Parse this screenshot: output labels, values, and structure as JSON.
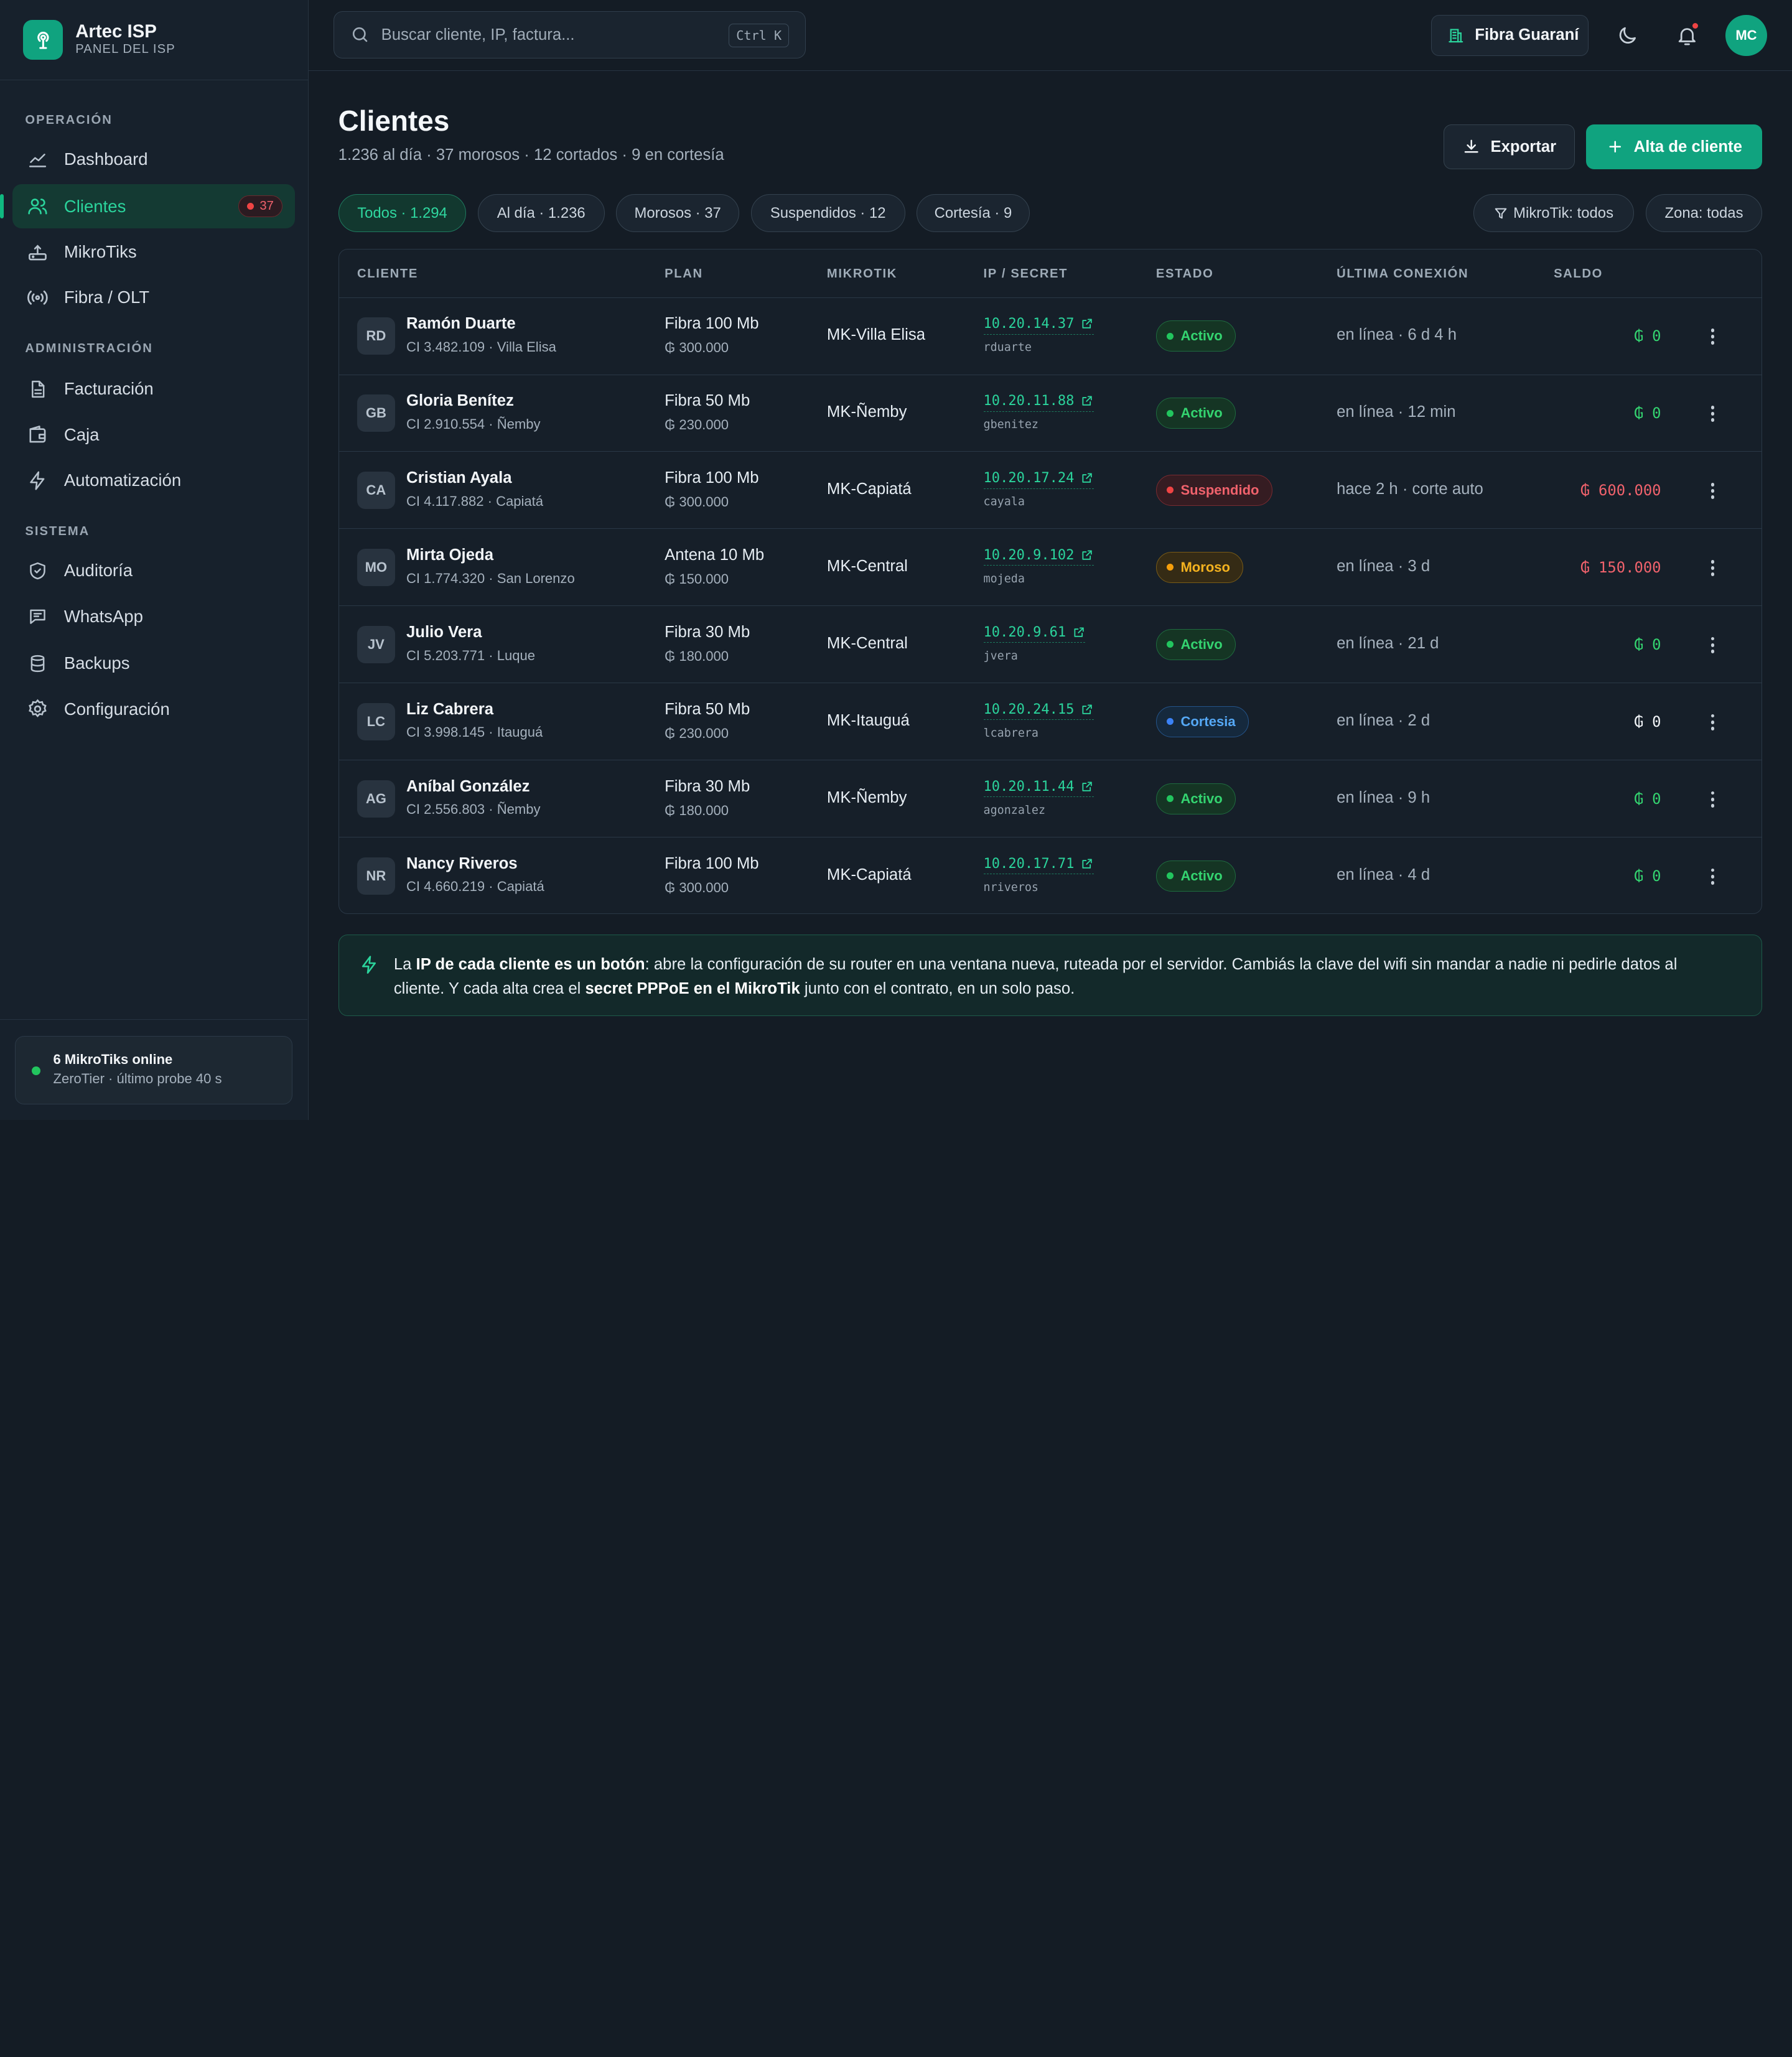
{
  "brand": {
    "name": "Artec ISP",
    "subtitle": "PANEL DEL ISP"
  },
  "sidebar": {
    "sections": [
      "OPERACIÓN",
      "ADMINISTRACIÓN",
      "SISTEMA"
    ],
    "items": [
      {
        "label": "Dashboard",
        "icon": "chart-line-icon"
      },
      {
        "label": "Clientes",
        "icon": "users-icon",
        "badge": "37",
        "active": true
      },
      {
        "label": "MikroTiks",
        "icon": "router-icon"
      },
      {
        "label": "Fibra / OLT",
        "icon": "broadcast-icon"
      },
      {
        "label": "Facturación",
        "icon": "invoice-icon"
      },
      {
        "label": "Caja",
        "icon": "wallet-icon"
      },
      {
        "label": "Automatización",
        "icon": "bolt-icon"
      },
      {
        "label": "Auditoría",
        "icon": "shield-icon"
      },
      {
        "label": "WhatsApp",
        "icon": "chat-icon"
      },
      {
        "label": "Backups",
        "icon": "database-icon"
      },
      {
        "label": "Configuración",
        "icon": "gear-icon"
      }
    ],
    "status": {
      "title": "6 MikroTiks online",
      "subtitle": "ZeroTier · último probe 40 s"
    }
  },
  "topbar": {
    "search_placeholder": "Buscar cliente, IP, factura...",
    "shortcut": "Ctrl K",
    "tenant": "Fibra Guaraní",
    "user_initials": "MC"
  },
  "page": {
    "title": "Clientes",
    "subtitle": "1.236 al día · 37 morosos · 12 cortados · 9 en cortesía",
    "export_label": "Exportar",
    "new_label": "Alta de cliente"
  },
  "filters": [
    "Todos · 1.294",
    "Al día · 1.236",
    "Morosos · 37",
    "Suspendidos · 12",
    "Cortesía · 9"
  ],
  "right_filters": [
    "MikroTik: todos",
    "Zona: todas"
  ],
  "table": {
    "columns": [
      "CLIENTE",
      "PLAN",
      "MIKROTIK",
      "IP / SECRET",
      "ESTADO",
      "ÚLTIMA CONEXIÓN",
      "SALDO"
    ],
    "rows": [
      {
        "initials": "RD",
        "name": "Ramón Duarte",
        "meta": "CI 3.482.109 · Villa Elisa",
        "plan": "Fibra 100 Mb",
        "price": "₲ 300.000",
        "mikrotik": "MK-Villa Elisa",
        "ip": "10.20.14.37",
        "secret": "rduarte",
        "state": "Activo",
        "state_kind": "active",
        "conn": "en línea · 6 d 4 h",
        "balance": "₲ 0",
        "bal_kind": "ok"
      },
      {
        "initials": "GB",
        "name": "Gloria Benítez",
        "meta": "CI 2.910.554 · Ñemby",
        "plan": "Fibra 50 Mb",
        "price": "₲ 230.000",
        "mikrotik": "MK-Ñemby",
        "ip": "10.20.11.88",
        "secret": "gbenitez",
        "state": "Activo",
        "state_kind": "active",
        "conn": "en línea · 12 min",
        "balance": "₲ 0",
        "bal_kind": "ok"
      },
      {
        "initials": "CA",
        "name": "Cristian Ayala",
        "meta": "CI 4.117.882 · Capiatá",
        "plan": "Fibra 100 Mb",
        "price": "₲ 300.000",
        "mikrotik": "MK-Capiatá",
        "ip": "10.20.17.24",
        "secret": "cayala",
        "state": "Suspendido",
        "state_kind": "suspended",
        "conn": "hace 2 h · corte auto",
        "balance": "₲ 600.000",
        "bal_kind": "debt"
      },
      {
        "initials": "MO",
        "name": "Mirta Ojeda",
        "meta": "CI 1.774.320 · San Lorenzo",
        "plan": "Antena 10 Mb",
        "price": "₲ 150.000",
        "mikrotik": "MK-Central",
        "ip": "10.20.9.102",
        "secret": "mojeda",
        "state": "Moroso",
        "state_kind": "late",
        "conn": "en línea · 3 d",
        "balance": "₲ 150.000",
        "bal_kind": "debt"
      },
      {
        "initials": "JV",
        "name": "Julio Vera",
        "meta": "CI 5.203.771 · Luque",
        "plan": "Fibra 30 Mb",
        "price": "₲ 180.000",
        "mikrotik": "MK-Central",
        "ip": "10.20.9.61",
        "secret": "jvera",
        "state": "Activo",
        "state_kind": "active",
        "conn": "en línea · 21 d",
        "balance": "₲ 0",
        "bal_kind": "ok"
      },
      {
        "initials": "LC",
        "name": "Liz Cabrera",
        "meta": "CI 3.998.145 · Itauguá",
        "plan": "Fibra 50 Mb",
        "price": "₲ 230.000",
        "mikrotik": "MK-Itauguá",
        "ip": "10.20.24.15",
        "secret": "lcabrera",
        "state": "Cortesia",
        "state_kind": "courtesy",
        "conn": "en línea · 2 d",
        "balance": "₲ 0",
        "bal_kind": "neutral"
      },
      {
        "initials": "AG",
        "name": "Aníbal González",
        "meta": "CI 2.556.803 · Ñemby",
        "plan": "Fibra 30 Mb",
        "price": "₲ 180.000",
        "mikrotik": "MK-Ñemby",
        "ip": "10.20.11.44",
        "secret": "agonzalez",
        "state": "Activo",
        "state_kind": "active",
        "conn": "en línea · 9 h",
        "balance": "₲ 0",
        "bal_kind": "ok"
      },
      {
        "initials": "NR",
        "name": "Nancy Riveros",
        "meta": "CI 4.660.219 · Capiatá",
        "plan": "Fibra 100 Mb",
        "price": "₲ 300.000",
        "mikrotik": "MK-Capiatá",
        "ip": "10.20.17.71",
        "secret": "nriveros",
        "state": "Activo",
        "state_kind": "active",
        "conn": "en línea · 4 d",
        "balance": "₲ 0",
        "bal_kind": "ok"
      }
    ]
  },
  "info": {
    "t1": "La ",
    "b1": "IP de cada cliente es un botón",
    "t2": ": abre la configuración de su router en una ventana nueva, ruteada por el servidor. Cambiás la clave del wifi sin mandar a nadie ni pedirle datos al cliente. Y cada alta crea el ",
    "b2": "secret PPPoE en el MikroTik",
    "t3": " junto con el contrato, en un solo paso."
  },
  "colors": {
    "accent": "#10a37f",
    "active": "#22c55e",
    "suspended": "#ef4444",
    "late": "#f59e0b",
    "courtesy": "#3b82f6"
  }
}
